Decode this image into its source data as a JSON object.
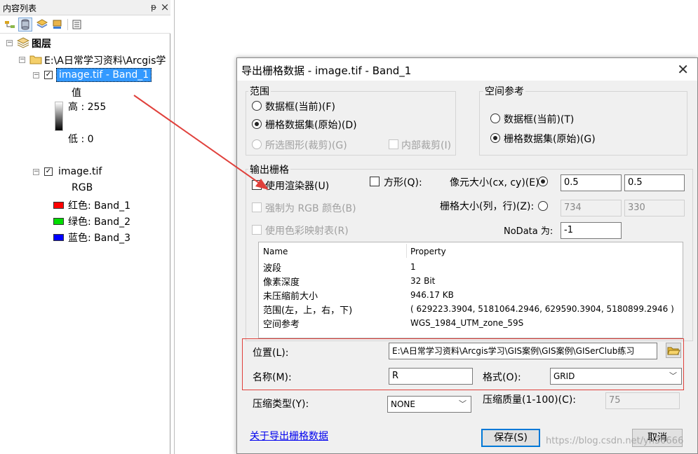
{
  "toc": {
    "title": "内容列表",
    "pin": "ᵽ",
    "close": "×",
    "root_label": "图层",
    "folder_label": "E:\\A日常学习资料\\Arcgis学",
    "layer1": {
      "name": "image.tif - Band_1",
      "legend_title": "值",
      "high": "高 : 255",
      "low": "低 : 0"
    },
    "layer2": {
      "name": "image.tif",
      "mode": "RGB",
      "bands": [
        {
          "label": "红色:   Band_1",
          "color": "#ff0000"
        },
        {
          "label": "绿色: Band_2",
          "color": "#00dd00"
        },
        {
          "label": "蓝色:   Band_3",
          "color": "#0000ff"
        }
      ]
    }
  },
  "dialog": {
    "title": "导出栅格数据 - image.tif - Band_1",
    "extent": {
      "label": "范围",
      "options": [
        "数据框(当前)(F)",
        "栅格数据集(原始)(D)",
        "所选图形(裁剪)(G)"
      ],
      "clip_inside": "内部裁剪(I)"
    },
    "spatial_ref": {
      "label": "空间参考",
      "options": [
        "数据框(当前)(T)",
        "栅格数据集(原始)(G)"
      ]
    },
    "output": {
      "label": "输出栅格",
      "use_renderer": "使用渲染器(U)",
      "square": "方形(Q):",
      "force_rgb": "强制为 RGB 颜色(B)",
      "use_colormap": "使用色彩映射表(R)",
      "cell_size_label": "像元大小(cx, cy)(E):",
      "cell_x": "0.5",
      "cell_y": "0.5",
      "raster_size_label": "栅格大小(列，行)(Z):",
      "cols": "734",
      "rows": "330",
      "nodata_label": "NoData 为:",
      "nodata": "-1"
    },
    "props": {
      "headers": [
        "Name",
        "Property"
      ],
      "rows": [
        [
          "波段",
          "1"
        ],
        [
          "像素深度",
          "32 Bit"
        ],
        [
          "未压缩前大小",
          "946.17 KB"
        ],
        [
          "范围(左，上，右，下)",
          "( 629223.3904, 5181064.2946, 629590.3904, 5180899.2946 )"
        ],
        [
          "空间参考",
          "WGS_1984_UTM_zone_59S"
        ]
      ]
    },
    "location_label": "位置(L):",
    "location": "E:\\A日常学习资料\\Arcgis学习\\GIS案例\\GIS案例\\GISerClub练习",
    "name_label": "名称(M):",
    "name": "R",
    "format_label": "格式(O):",
    "format": "GRID",
    "compress_label": "压缩类型(Y):",
    "compress": "NONE",
    "quality_label": "压缩质量(1-100)(C):",
    "quality": "75",
    "help_link": "关于导出栅格数据",
    "save": "保存(S)",
    "cancel": "取消"
  },
  "watermark": "https://blog.csdn.net/yh30666",
  "colors": {
    "accent": "#0078d7",
    "selection": "#3399ff",
    "annotation": "#e0403b"
  }
}
